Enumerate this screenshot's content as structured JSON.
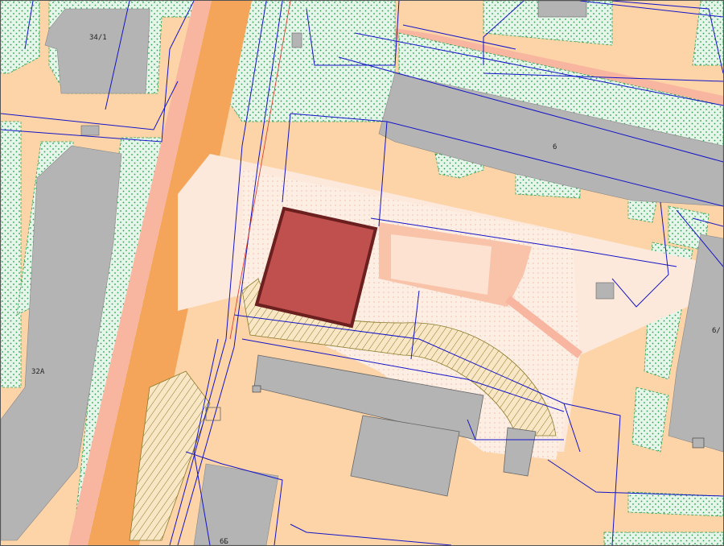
{
  "map": {
    "colors": {
      "background": "#fcd4a8",
      "building": "#b4b4b4",
      "green_area": "#e6f5ea",
      "green_dots": "#27a24a",
      "road_main": "#f5a55a",
      "road_pink": "#f8b6a0",
      "light_zone": "#fde9dc",
      "parcel_lines": "#1414c8",
      "highlight_parcel": "#c0504d",
      "highlight_border": "#6b1f1f",
      "hatch": "#8a7a2a"
    },
    "building_labels": [
      {
        "id": "b-34-1",
        "text": "34/1"
      },
      {
        "id": "b-6",
        "text": "6"
      },
      {
        "id": "b-32a",
        "text": "32A"
      },
      {
        "id": "b-6-right",
        "text": "6/"
      },
      {
        "id": "b-bottom",
        "text": "6Б"
      }
    ]
  }
}
